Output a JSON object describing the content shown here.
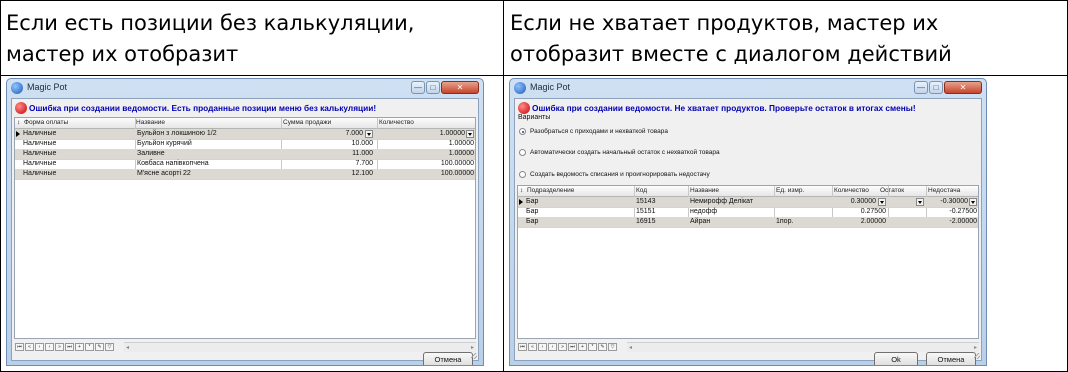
{
  "captions": {
    "left": "Если есть позиции без калькуляции,\nмастер их отобразит",
    "right": "Если не хватает продуктов, мастер их\nотобразит вместе с диалогом действий"
  },
  "left_window": {
    "title": "Magic Pot",
    "error": "Ошибка при создании ведомости. Есть проданные позиции меню без калькуляции!",
    "columns": [
      "Форма оплаты",
      "Название",
      "Сумма продажи",
      "Количество"
    ],
    "rows": [
      {
        "pay": "Наличные",
        "name": "Бульйон з локшиною 1/2",
        "sum": "7.000",
        "qty": "1.00000"
      },
      {
        "pay": "Наличные",
        "name": "Бульйон курячий",
        "sum": "10.000",
        "qty": "1.00000"
      },
      {
        "pay": "Наличные",
        "name": "Заливне",
        "sum": "11.000",
        "qty": "1.00000"
      },
      {
        "pay": "Наличные",
        "name": "Ковбаса напівкопчена",
        "sum": "7.700",
        "qty": "100.00000"
      },
      {
        "pay": "Наличные",
        "name": "М'ясне асорті 22",
        "sum": "12.100",
        "qty": "100.00000"
      }
    ],
    "cancel_label": "Отмена"
  },
  "right_window": {
    "title": "Magic Pot",
    "error": "Ошибка при создании ведомости. Не хватает продуктов. Проверьте остаток в итогах смены!",
    "variants_label": "Варианты",
    "options": [
      "Разобраться с приходами и нехваткой товара",
      "Автоматически создать начальный остаток с нехваткой товара",
      "Создать ведомость списания и проигнорировать недостачу"
    ],
    "selected_option": 0,
    "columns": [
      "Подразделение",
      "Код",
      "Название",
      "Ед. измр.",
      "Количество",
      "Остаток",
      "Недостача"
    ],
    "rows": [
      {
        "dept": "Бар",
        "code": "15143",
        "name": "Немирофф Делікат",
        "unit": "",
        "qty": "0.30000",
        "rest": "",
        "short": "-0.30000"
      },
      {
        "dept": "Бар",
        "code": "15151",
        "name": "недофф",
        "unit": "",
        "qty": "0.27500",
        "rest": "",
        "short": "-0.27500"
      },
      {
        "dept": "Бар",
        "code": "16915",
        "name": "Айран",
        "unit": "1пор.",
        "qty": "2.00000",
        "rest": "",
        "short": "-2.00000"
      }
    ],
    "ok_label": "Ok",
    "cancel_label": "Отмена"
  },
  "window_controls": {
    "minimize": "—",
    "maximize": "□",
    "close": "✕"
  },
  "navigator_icons": [
    "first-record-icon",
    "prev-page-icon",
    "prev-record-icon",
    "next-record-icon",
    "next-page-icon",
    "last-record-icon",
    "insert-record-icon",
    "delete-record-icon",
    "edit-record-icon",
    "filter-icon"
  ],
  "colors": {
    "error_text": "#0000b4",
    "alt_row": "#dcd9d2",
    "title_gradient": "#cfe0f3"
  }
}
